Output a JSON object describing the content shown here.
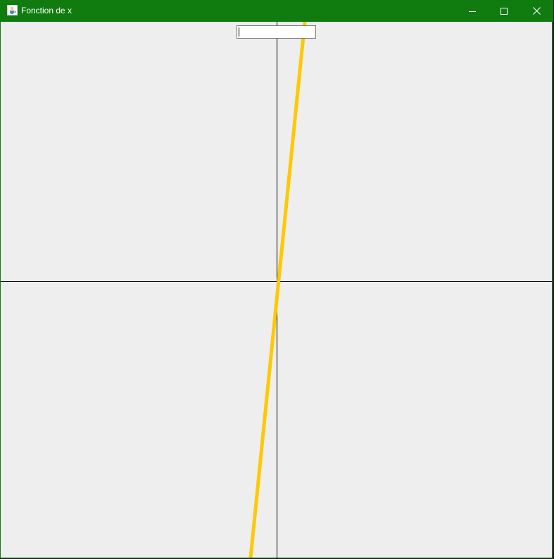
{
  "window": {
    "title": "Fonction de x",
    "titlebar_color": "#107c10",
    "app_icon": "java-cup-icon",
    "controls": {
      "minimize_icon": "minimize-icon",
      "maximize_icon": "maximize-icon",
      "close_icon": "close-icon"
    }
  },
  "expression_input": {
    "value": "",
    "placeholder": ""
  },
  "plot": {
    "background": "#eeeeee",
    "axis_color": "#000000",
    "curve_color": "#ffc800"
  }
}
